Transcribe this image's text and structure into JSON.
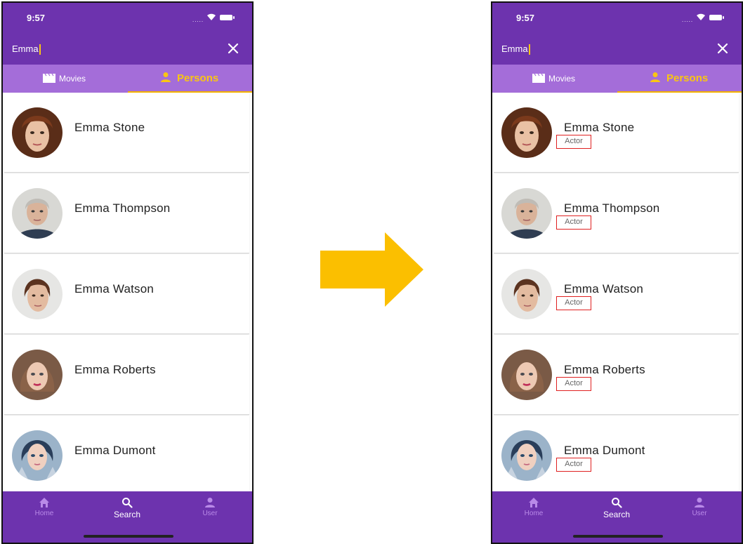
{
  "status": {
    "time": "9:57",
    "signal": "....."
  },
  "search": {
    "query": "Emma"
  },
  "tabs": [
    {
      "label": "Movies",
      "icon": "movie-clapper-icon",
      "active": false
    },
    {
      "label": "Persons",
      "icon": "person-icon",
      "active": true
    }
  ],
  "before": {
    "persons": [
      {
        "name": "Emma Stone"
      },
      {
        "name": "Emma Thompson"
      },
      {
        "name": "Emma Watson"
      },
      {
        "name": "Emma Roberts"
      },
      {
        "name": "Emma Dumont"
      }
    ]
  },
  "after": {
    "persons": [
      {
        "name": "Emma Stone",
        "role": "Actor"
      },
      {
        "name": "Emma Thompson",
        "role": "Actor"
      },
      {
        "name": "Emma Watson",
        "role": "Actor"
      },
      {
        "name": "Emma Roberts",
        "role": "Actor"
      },
      {
        "name": "Emma Dumont",
        "role": "Actor"
      }
    ]
  },
  "nav": [
    {
      "label": "Home",
      "icon": "home-icon",
      "active": false
    },
    {
      "label": "Search",
      "icon": "search-icon",
      "active": true
    },
    {
      "label": "User",
      "icon": "user-icon",
      "active": false
    }
  ],
  "colors": {
    "primary": "#6d33ae",
    "tab_bar": "#a46dd9",
    "accent": "#f9c513",
    "arrow": "#fbbf00",
    "highlight_box": "#e02020"
  }
}
